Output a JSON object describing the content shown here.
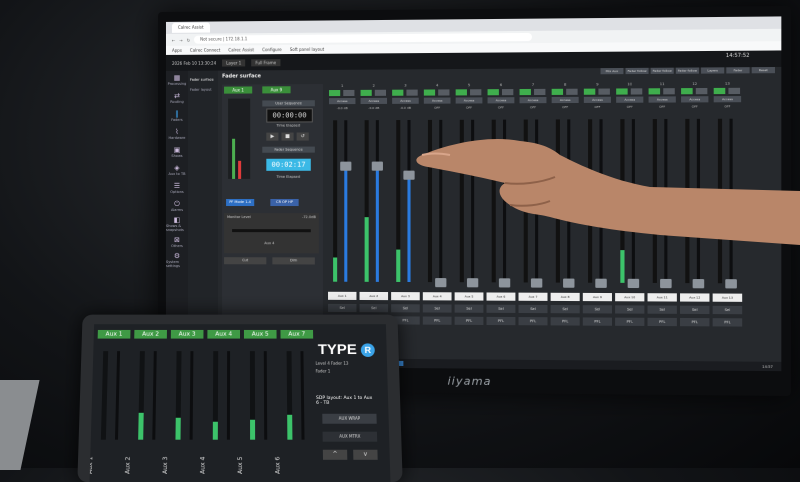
{
  "browser": {
    "tab_label": "Calrec Assist",
    "url": "Not secure | 172.18.1.1",
    "bookmarks": [
      "Apps",
      "Calrec Connect",
      "Calrec Assist",
      "Configure",
      "Soft panel layout"
    ]
  },
  "app": {
    "datetime": "2026 Feb 10 13:30:24",
    "panel_title": "Fader surface",
    "header_buttons": [
      "Layer 1",
      "Full Frame"
    ],
    "clock": "14:57:52",
    "sidebar": [
      {
        "label": "Processing",
        "glyph": "▦"
      },
      {
        "label": "Routing",
        "glyph": "⇄"
      },
      {
        "label": "Faders",
        "glyph": "‖",
        "active": true
      },
      {
        "label": "Hardware",
        "glyph": "⌇"
      },
      {
        "label": "Shows",
        "glyph": "▣"
      },
      {
        "label": "Aux to TB",
        "glyph": "◈"
      },
      {
        "label": "Options",
        "glyph": "☰"
      },
      {
        "label": "Alarms",
        "glyph": "⏻"
      },
      {
        "label": "Shows & snapshots",
        "glyph": "◧"
      },
      {
        "label": "Others",
        "glyph": "⊠"
      },
      {
        "label": "System settings",
        "glyph": "⚙"
      }
    ],
    "subnav": [
      "Fader surface",
      "Fader layout"
    ],
    "left_panel": {
      "aux_a": "Aux 1",
      "aux_b": "Aux 9",
      "timer_title": "User Sequence",
      "timer_1": "00:00:00",
      "time_elapsed": "Time Elapsed",
      "fader_sequence": "Fader Sequence",
      "timer_2": "00:02:17",
      "btn_a": "PF Mode 1-4",
      "btn_b": "CR OP HP",
      "monitor_level": "Monitor Level",
      "monitor_value": "-72.0dB",
      "monitor_output": "Aux 4",
      "btn_cut": "Cut",
      "btn_dim": "Dim"
    },
    "top_buttons": [
      "Mix Aux",
      "Fader follow",
      "Fader follow",
      "Fader follow",
      "Layers",
      "Fader",
      "Reset"
    ],
    "strip_grey_labels": [
      "Access",
      "TB"
    ],
    "strips": [
      {
        "num": "1",
        "db": "-0.0 dB",
        "name": "Aux 1",
        "fader": 0.72,
        "meter": 0.15
      },
      {
        "num": "2",
        "db": "-0.0 dB",
        "name": "Aux 2",
        "fader": 0.72,
        "meter": 0.4
      },
      {
        "num": "3",
        "db": "-0.0 dB",
        "name": "Aux 3",
        "fader": 0.66,
        "meter": 0.2
      },
      {
        "num": "4",
        "db": "OFF",
        "name": "Aux 4",
        "fader": 0.0,
        "meter": 0.0
      },
      {
        "num": "5",
        "db": "OFF",
        "name": "Aux 5",
        "fader": 0.0,
        "meter": 0.0
      },
      {
        "num": "6",
        "db": "OFF",
        "name": "Aux 6",
        "fader": 0.0,
        "meter": 0.0
      },
      {
        "num": "7",
        "db": "OFF",
        "name": "Aux 7",
        "fader": 0.0,
        "meter": 0.0
      },
      {
        "num": "8",
        "db": "OFF",
        "name": "Aux 8",
        "fader": 0.0,
        "meter": 0.0
      },
      {
        "num": "9",
        "db": "OFF",
        "name": "Aux 9",
        "fader": 0.0,
        "meter": 0.0
      },
      {
        "num": "10",
        "db": "OFF",
        "name": "Aux 10",
        "fader": 0.0,
        "meter": 0.2
      },
      {
        "num": "11",
        "db": "OFF",
        "name": "Aux 11",
        "fader": 0.0,
        "meter": 0.0
      },
      {
        "num": "12",
        "db": "OFF",
        "name": "Aux 12",
        "fader": 0.0,
        "meter": 0.0
      },
      {
        "num": "13",
        "db": "OFF",
        "name": "Aux 13",
        "fader": 0.0,
        "meter": 0.0
      }
    ],
    "strip_sel": "Sel",
    "strip_pfl": "PFL",
    "taskbar_clock": "14:57"
  },
  "monitor_brand": "iiyama",
  "tablet": {
    "aux_headers": [
      "Aux 1",
      "Aux 2",
      "Aux 3",
      "Aux 4",
      "Aux 5",
      "Aux 7"
    ],
    "strips": [
      {
        "label": "Aux 1",
        "meter": 0.0
      },
      {
        "label": "Aux 2",
        "meter": 0.3
      },
      {
        "label": "Aux 3",
        "meter": 0.25
      },
      {
        "label": "Aux 4",
        "meter": 0.2
      },
      {
        "label": "Aux 5",
        "meter": 0.22
      },
      {
        "label": "Aux 6",
        "meter": 0.28
      }
    ],
    "logo": "TYPE",
    "logo_mark": "R",
    "line1": "Level 4   Fader 13",
    "line2": "Fader 1",
    "info": "SDP layout: Aux 1 to Aux 6 - TB",
    "btn_1": "AUX WRAP",
    "btn_2": "AUX MTRX",
    "arrow_up": "^",
    "arrow_down": "v"
  },
  "colors": {
    "accent_green": "#3fae4d",
    "accent_blue": "#2a7be0",
    "timer_blue": "#3bb9e6"
  }
}
